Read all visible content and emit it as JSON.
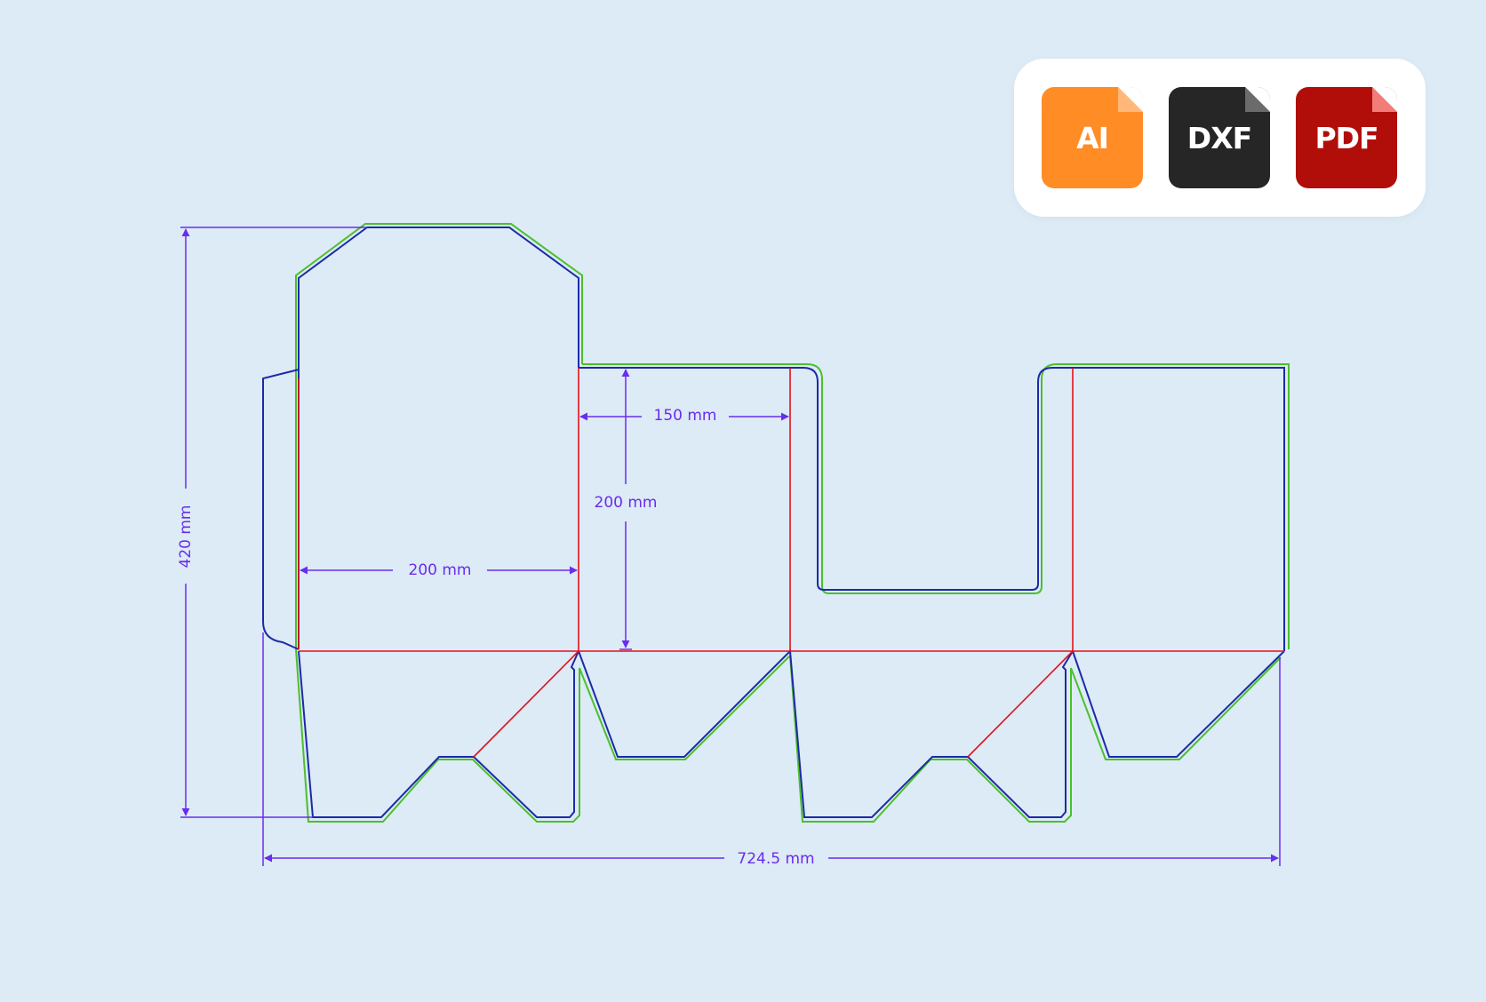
{
  "dimensions": {
    "overall_height": "420 mm",
    "overall_width": "724.5 mm",
    "panel_front_width": "200 mm",
    "panel_side_width": "150 mm",
    "panel_height": "200 mm"
  },
  "formats": [
    {
      "label": "AI",
      "color": "#ff8c25",
      "fold_color": "#ffb878",
      "icon": "file-icon"
    },
    {
      "label": "DXF",
      "color": "#262626",
      "fold_color": "#6b6b6b",
      "icon": "file-icon"
    },
    {
      "label": "PDF",
      "color": "#b10e0a",
      "fold_color": "#f27c78",
      "icon": "file-icon"
    }
  ],
  "colors": {
    "background": "#dcebf5",
    "cut_line": "#1c2aa8",
    "bleed_line": "#4cbf2c",
    "fold_line": "#e3101c",
    "dimension_line": "#6a2cf0"
  }
}
